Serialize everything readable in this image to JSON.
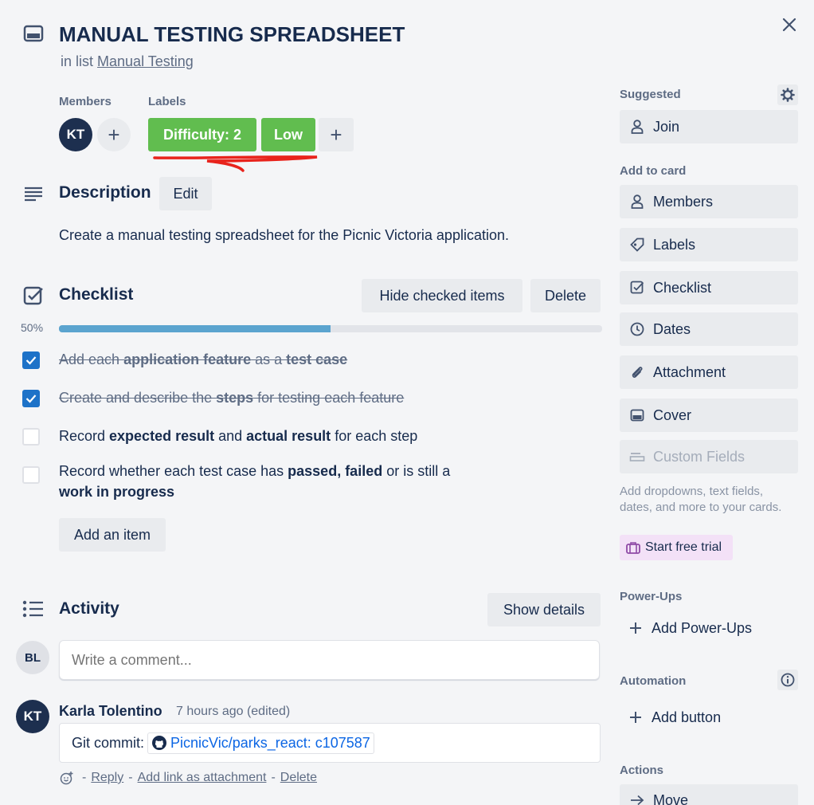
{
  "card": {
    "title": "MANUAL TESTING SPREADSHEET",
    "in_list_prefix": "in list",
    "list_name": "Manual Testing"
  },
  "members": {
    "label": "Members",
    "avatar_initials": "KT",
    "add": "+"
  },
  "labels": {
    "label": "Labels",
    "items": [
      {
        "text": "Difficulty: 2",
        "color": "#61bd4f"
      },
      {
        "text": "Low",
        "color": "#61bd4f"
      }
    ],
    "add": "+"
  },
  "description": {
    "title": "Description",
    "edit_label": "Edit",
    "text": "Create a manual testing spreadsheet for the Picnic Victoria application."
  },
  "checklist": {
    "title": "Checklist",
    "hide_checked_label": "Hide checked items",
    "delete_label": "Delete",
    "progress_text": "50%",
    "progress_fraction": 0.5,
    "progress_color": "#5ba4cf",
    "items": [
      {
        "checked": true,
        "parts": [
          {
            "t": "Add each ",
            "b": false
          },
          {
            "t": "application feature",
            "b": true
          },
          {
            "t": " as a ",
            "b": false
          },
          {
            "t": "test case",
            "b": true
          }
        ]
      },
      {
        "checked": true,
        "parts": [
          {
            "t": "Create and describe the ",
            "b": false
          },
          {
            "t": "steps",
            "b": true
          },
          {
            "t": " for testing each feature",
            "b": false
          }
        ]
      },
      {
        "checked": false,
        "parts": [
          {
            "t": "Record ",
            "b": false
          },
          {
            "t": "expected result",
            "b": true
          },
          {
            "t": " and ",
            "b": false
          },
          {
            "t": "actual result",
            "b": true
          },
          {
            "t": " for each step",
            "b": false
          }
        ]
      },
      {
        "checked": false,
        "parts": [
          {
            "t": "Record whether each test case has ",
            "b": false
          },
          {
            "t": "passed, failed",
            "b": true
          },
          {
            "t": " or is still a",
            "b": false
          }
        ]
      }
    ],
    "item4_line2": "work in progress",
    "add_item_label": "Add an item"
  },
  "activity": {
    "title": "Activity",
    "show_details_label": "Show details",
    "current_user_initials": "BL",
    "comment_placeholder": "Write a comment...",
    "comment": {
      "author_initials": "KT",
      "author": "Karla Tolentino",
      "time": "7 hours ago (edited)",
      "text_prefix": "Git commit:",
      "link_text": "PicnicVic/parks_react: c107587",
      "actions": [
        "Reply",
        "Add link as attachment",
        "Delete"
      ],
      "separator": "-"
    }
  },
  "sidebar": {
    "suggested_label": "Suggested",
    "join_label": "Join",
    "add_to_card_label": "Add to card",
    "add_to_card": [
      "Members",
      "Labels",
      "Checklist",
      "Dates",
      "Attachment",
      "Cover"
    ],
    "custom_fields_label": "Custom Fields",
    "custom_fields_desc": "Add dropdowns, text fields, dates, and more to your cards.",
    "start_trial_label": "Start free trial",
    "powerups_label": "Power-Ups",
    "add_powerups_label": "Add Power-Ups",
    "automation_label": "Automation",
    "add_button_label": "Add button",
    "actions_label": "Actions",
    "move_label": "Move"
  },
  "colors": {
    "avatar_dark": "#1d2f4f",
    "checkbox_checked": "#1d72c8",
    "annotation_red": "#e8231c",
    "link_blue": "#0c66e4",
    "trial_bg": "#f3e1f7"
  }
}
